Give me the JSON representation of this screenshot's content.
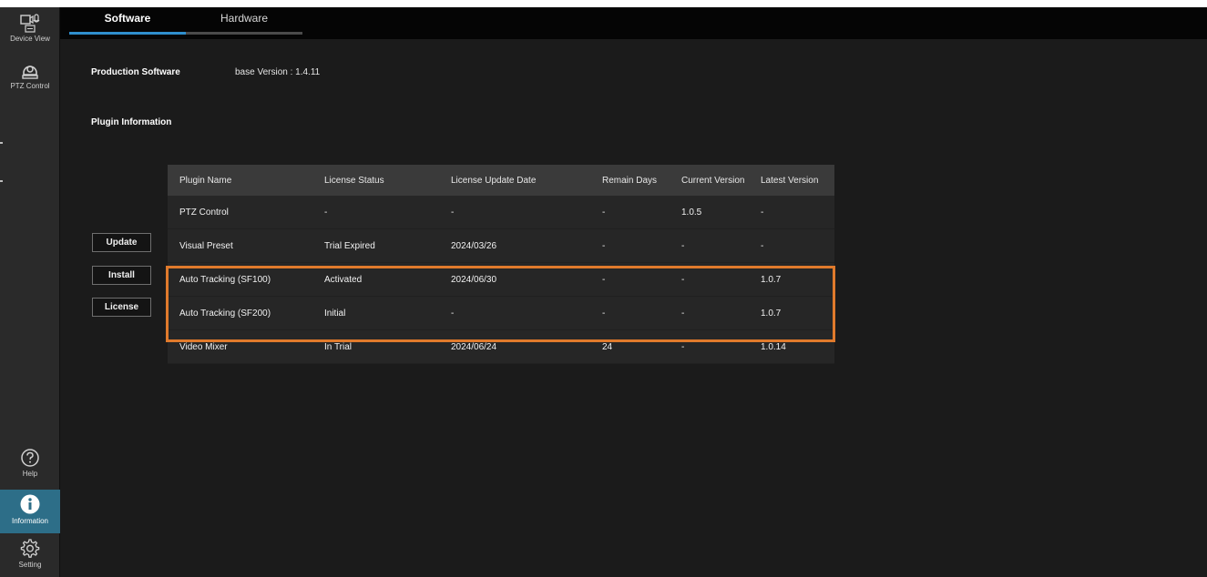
{
  "sidebar": {
    "items": [
      {
        "label": "Device View",
        "icon": "device-view-icon"
      },
      {
        "label": "PTZ Control",
        "icon": "ptz-camera-icon"
      },
      {
        "label": "Help",
        "icon": "help-icon"
      },
      {
        "label": "Information",
        "icon": "info-icon",
        "active": true
      },
      {
        "label": "Setting",
        "icon": "gear-icon"
      }
    ]
  },
  "tabs": [
    {
      "label": "Software",
      "active": true
    },
    {
      "label": "Hardware",
      "active": false
    }
  ],
  "production_software": {
    "label": "Production Software",
    "version": "base Version : 1.4.11"
  },
  "plugin_information": {
    "label": "Plugin Information"
  },
  "buttons": {
    "update": "Update",
    "install": "Install",
    "license": "License"
  },
  "table": {
    "columns": [
      "Plugin Name",
      "License Status",
      "License Update Date",
      "Remain Days",
      "Current Version",
      "Latest Version"
    ],
    "rows": [
      [
        "PTZ Control",
        "-",
        "-",
        "-",
        "1.0.5",
        "-"
      ],
      [
        "Visual Preset",
        "Trial Expired",
        "2024/03/26",
        "-",
        "-",
        "-"
      ],
      [
        "Auto Tracking (SF100)",
        "Activated",
        "2024/06/30",
        "-",
        "-",
        "1.0.7"
      ],
      [
        "Auto Tracking (SF200)",
        "Initial",
        "-",
        "-",
        "-",
        "1.0.7"
      ],
      [
        "Video Mixer",
        "In Trial",
        "2024/06/24",
        "24",
        "-",
        "1.0.14"
      ]
    ]
  },
  "colors": {
    "accent": "#2f8fce",
    "active_sidebar": "#2d6e88",
    "highlight": "#e07a2c",
    "background": "#1b1b1b"
  }
}
